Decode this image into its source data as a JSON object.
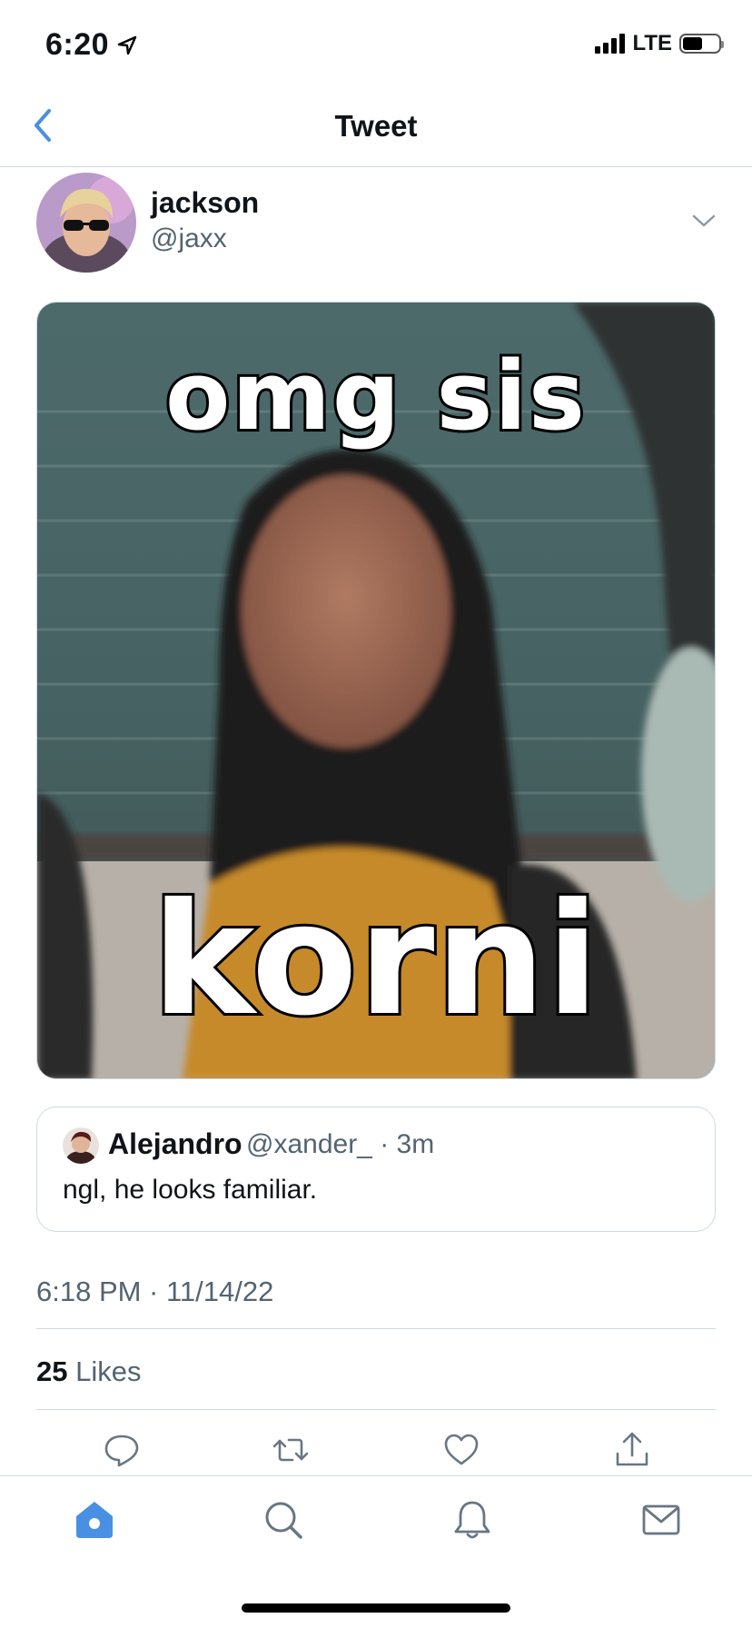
{
  "status_bar": {
    "time": "6:20",
    "network": "LTE"
  },
  "header": {
    "title": "Tweet"
  },
  "tweet": {
    "author_name": "jackson",
    "author_handle": "@jaxx",
    "meme_top_text": "omg sis",
    "meme_bottom_text": "korni",
    "timestamp": "6:18 PM · 11/14/22",
    "likes_count": "25",
    "likes_label": "Likes"
  },
  "quoted_tweet": {
    "author_name": "Alejandro",
    "author_handle": "@xander_ · 3m",
    "text": "ngl, he looks familiar."
  },
  "colors": {
    "accent": "#1d9bf0",
    "tab_active": "#4a90e2",
    "secondary_text": "#536471",
    "divider": "#cfd9de"
  },
  "icons": {
    "actions": [
      "reply-icon",
      "retweet-icon",
      "like-icon",
      "share-icon"
    ],
    "tabs": [
      "home-icon",
      "search-icon",
      "notifications-icon",
      "messages-icon"
    ]
  }
}
